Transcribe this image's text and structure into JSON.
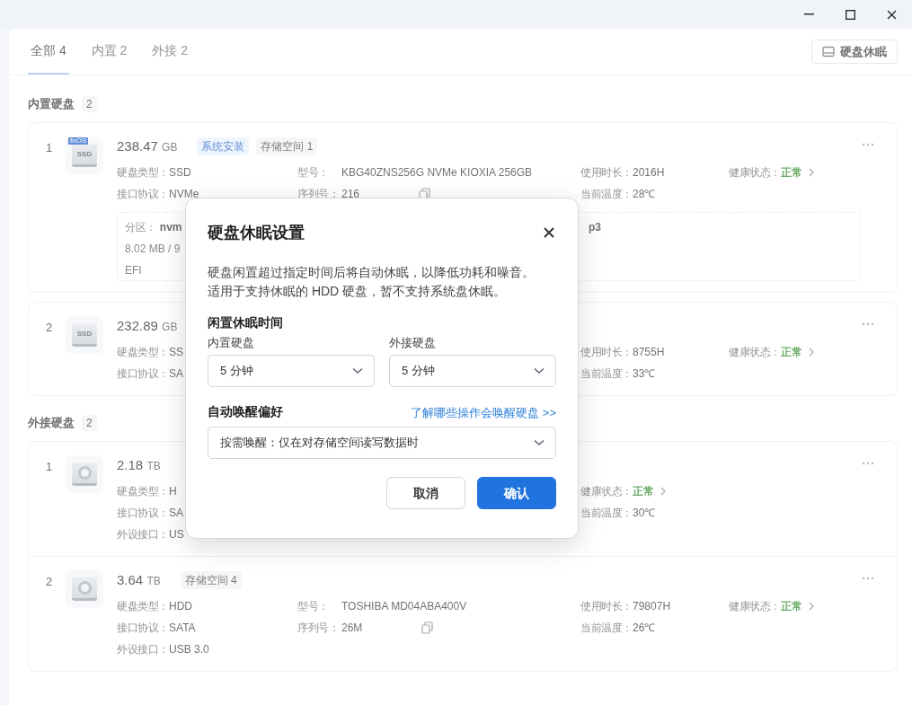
{
  "tabs": [
    {
      "label": "全部 4",
      "selected": true
    },
    {
      "label": "内置 2",
      "selected": false
    },
    {
      "label": "外接 2",
      "selected": false
    }
  ],
  "sleep_button": "硬盘休眠",
  "sections": [
    {
      "title": "内置硬盘",
      "count": "2",
      "disks": [
        {
          "index": "1",
          "icon": {
            "kind": "ssd",
            "text": "SSD",
            "badge": "fnOS"
          },
          "size": "238.47",
          "unit": "GB",
          "tags": [
            {
              "label": "系统安装",
              "kind": "system"
            },
            {
              "label": "存储空间 1",
              "kind": "storage"
            }
          ],
          "rows": [
            [
              {
                "label": "硬盘类型：",
                "value": "SSD"
              },
              {
                "label": "型号：",
                "value": "KBG40ZNS256G NVMe KIOXIA 256GB",
                "kind": "wide"
              },
              {
                "label": "使用时长：",
                "value": "2016H"
              },
              {
                "label": "健康状态：",
                "value": "正常",
                "kind": "status"
              }
            ],
            [
              {
                "label": "接口协议：",
                "value": "NVMe"
              },
              {
                "label": "序列号：",
                "value": "216",
                "kind": "serial"
              },
              {
                "label": "当前温度：",
                "value": "28℃"
              },
              null
            ]
          ],
          "partition": {
            "label": "分区：",
            "name": "nvm",
            "usage": "8.02 MB / 9",
            "type": "EFI",
            "second": "p3"
          }
        },
        {
          "index": "2",
          "icon": {
            "kind": "ssd",
            "text": "SSD"
          },
          "size": "232.89",
          "unit": "GB",
          "rows": [
            [
              {
                "label": "硬盘类型：",
                "value": "SS"
              },
              null,
              {
                "label": "使用时长：",
                "value": "8755H"
              },
              {
                "label": "健康状态：",
                "value": "正常",
                "kind": "status"
              }
            ],
            [
              {
                "label": "接口协议：",
                "value": "SA"
              },
              null,
              {
                "label": "当前温度：",
                "value": "33℃"
              },
              null
            ]
          ]
        }
      ]
    },
    {
      "title": "外接硬盘",
      "count": "2",
      "disks": [
        {
          "index": "1",
          "icon": {
            "kind": "hdd"
          },
          "size": "2.18",
          "unit": "TB",
          "rows": [
            [
              {
                "label": "硬盘类型：",
                "value": "H"
              },
              null,
              {
                "label": "健康状态：",
                "value": "正常",
                "kind": "status"
              },
              null
            ],
            [
              {
                "label": "接口协议：",
                "value": "SA"
              },
              null,
              {
                "label": "当前温度：",
                "value": "30℃"
              },
              null
            ],
            [
              {
                "label": "外设接口：",
                "value": "US"
              },
              null,
              null,
              null
            ]
          ]
        },
        {
          "index": "2",
          "icon": {
            "kind": "hdd"
          },
          "size": "3.64",
          "unit": "TB",
          "tags": [
            {
              "label": "存储空间 4",
              "kind": "storage"
            }
          ],
          "rows": [
            [
              {
                "label": "硬盘类型：",
                "value": "HDD"
              },
              {
                "label": "型号：",
                "value": "TOSHIBA MD04ABA400V",
                "kind": "wide"
              },
              {
                "label": "使用时长：",
                "value": "79807H"
              },
              {
                "label": "健康状态：",
                "value": "正常",
                "kind": "status"
              }
            ],
            [
              {
                "label": "接口协议：",
                "value": "SATA"
              },
              {
                "label": "序列号：",
                "value": "26M",
                "kind": "serial"
              },
              {
                "label": "当前温度：",
                "value": "26℃"
              },
              null
            ],
            [
              {
                "label": "外设接口：",
                "value": "USB 3.0"
              },
              null,
              null,
              null
            ]
          ]
        }
      ]
    }
  ],
  "dialog": {
    "title": "硬盘休眠设置",
    "description": "硬盘闲置超过指定时间后将自动休眠，以降低功耗和噪音。适用于支持休眠的 HDD 硬盘，暂不支持系统盘休眠。",
    "idle_section": "闲置休眠时间",
    "idle_fields": [
      {
        "label": "内置硬盘",
        "value": "5 分钟"
      },
      {
        "label": "外接硬盘",
        "value": "5 分钟"
      }
    ],
    "wake_section": "自动唤醒偏好",
    "wake_link": "了解哪些操作会唤醒硬盘 >>",
    "wake_value": "按需唤醒：仅在对存储空间读写数据时",
    "buttons": [
      {
        "label": "取消",
        "kind": "secondary"
      },
      {
        "label": "确认",
        "kind": "primary"
      }
    ]
  }
}
